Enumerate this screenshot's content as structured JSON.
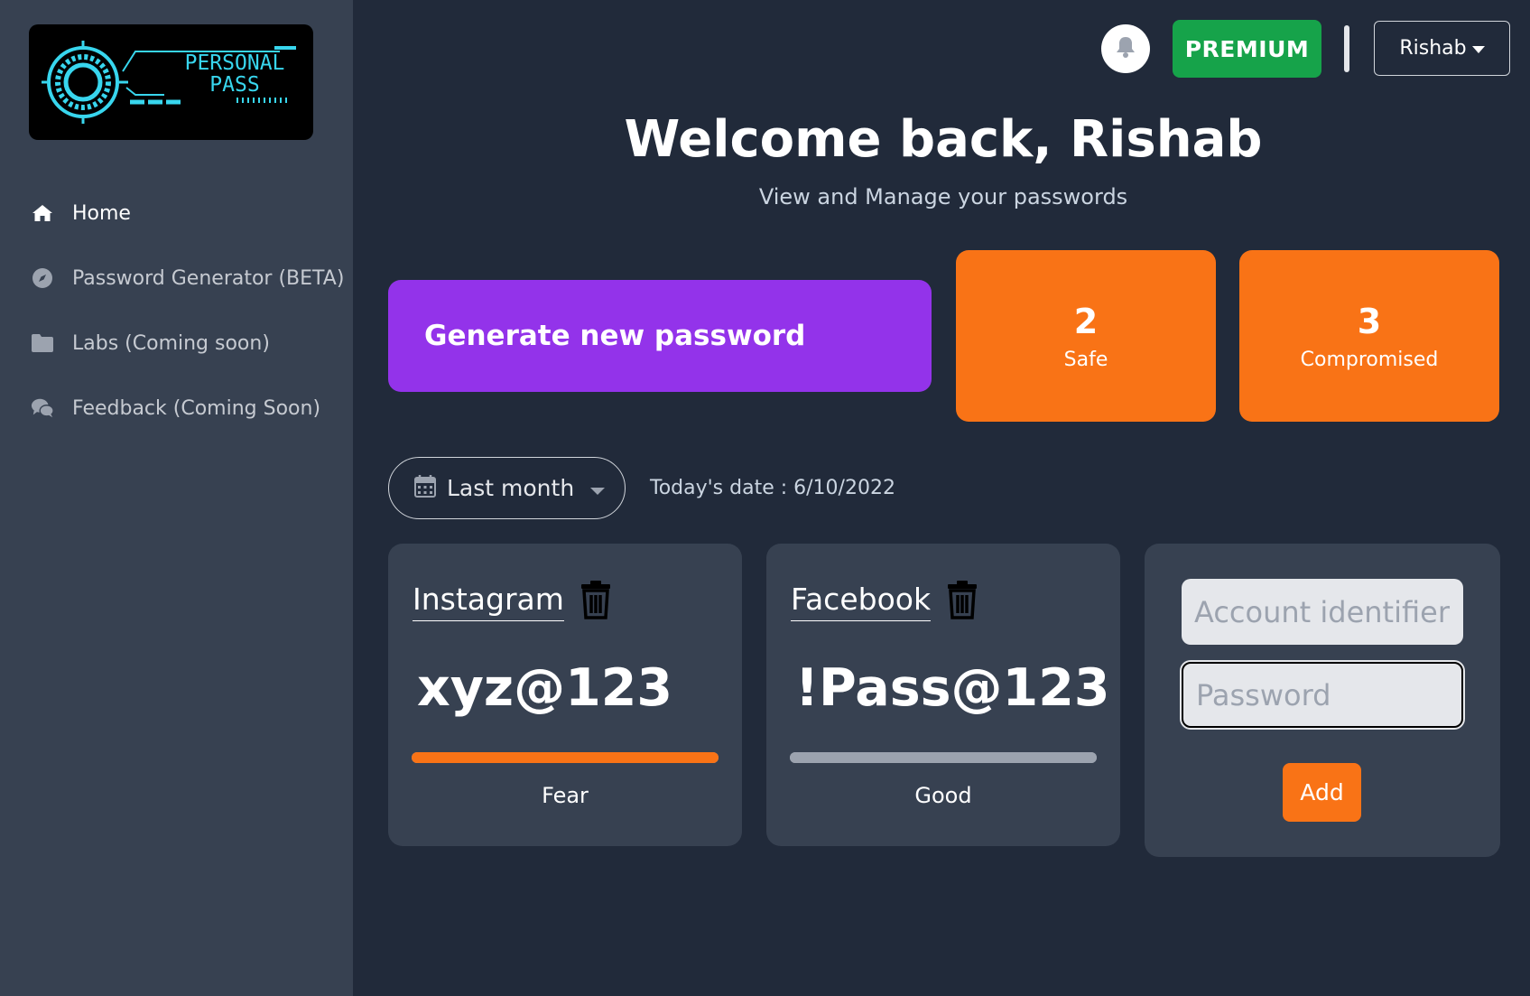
{
  "sidebar": {
    "logo_text": [
      "PERSONAL",
      "PASS"
    ],
    "items": [
      {
        "label": "Home",
        "icon": "home-icon",
        "active": true
      },
      {
        "label": "Password Generator (BETA)",
        "icon": "compass-icon",
        "active": false
      },
      {
        "label": "Labs (Coming soon)",
        "icon": "folder-icon",
        "active": false
      },
      {
        "label": "Feedback (Coming Soon)",
        "icon": "chat-icon",
        "active": false
      }
    ]
  },
  "header": {
    "premium_label": "PREMIUM",
    "user_name": "Rishab",
    "notification_icon": "bell-icon"
  },
  "main": {
    "title": "Welcome back, Rishab",
    "subtitle": "View and Manage your passwords",
    "generate_label": "Generate new password",
    "stats": [
      {
        "value": "2",
        "label": "Safe"
      },
      {
        "value": "3",
        "label": "Compromised"
      }
    ],
    "date_filter": "Last month",
    "today": "Today's date : 6/10/2022"
  },
  "cards": [
    {
      "account": "Instagram",
      "password": "xyz@123",
      "strength": "Fear",
      "strength_level": 1.0,
      "bar_color": "#f97316"
    },
    {
      "account": "Facebook",
      "password": "!Pass@123",
      "strength": "Good",
      "strength_level": 1.0,
      "bar_color": "#9ca3af"
    }
  ],
  "form": {
    "account_placeholder": "Account identifier",
    "password_placeholder": "Password",
    "add_label": "Add"
  },
  "colors": {
    "background": "#212a3a",
    "sidebar": "#374151",
    "purple": "#9333ea",
    "orange": "#f97316",
    "green": "#16a34a",
    "logo_cyan": "#38d6ee"
  }
}
